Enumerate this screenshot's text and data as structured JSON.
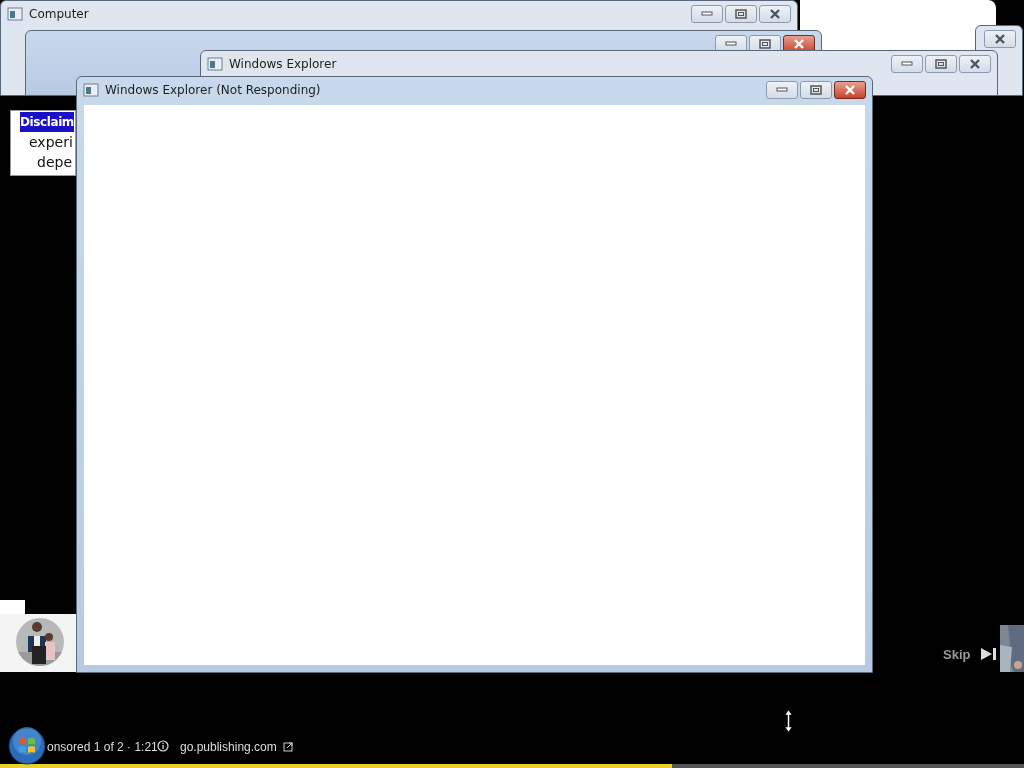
{
  "windows": [
    {
      "title": "Computer",
      "active": false
    },
    {
      "active": true
    },
    {
      "active": false
    },
    {
      "title": "Windows Explorer",
      "active": false
    },
    {
      "title": "Windows Explorer (Not Responding)",
      "active": true
    }
  ],
  "disclaimer": {
    "heading": "Disclaim",
    "lines": [
      "experi",
      "depe"
    ]
  },
  "ad": {
    "skip": "Skip",
    "sponsor_text": "onsored 1 of 2 · 1:21",
    "link": "go.publishing.com",
    "level": 0.656
  }
}
